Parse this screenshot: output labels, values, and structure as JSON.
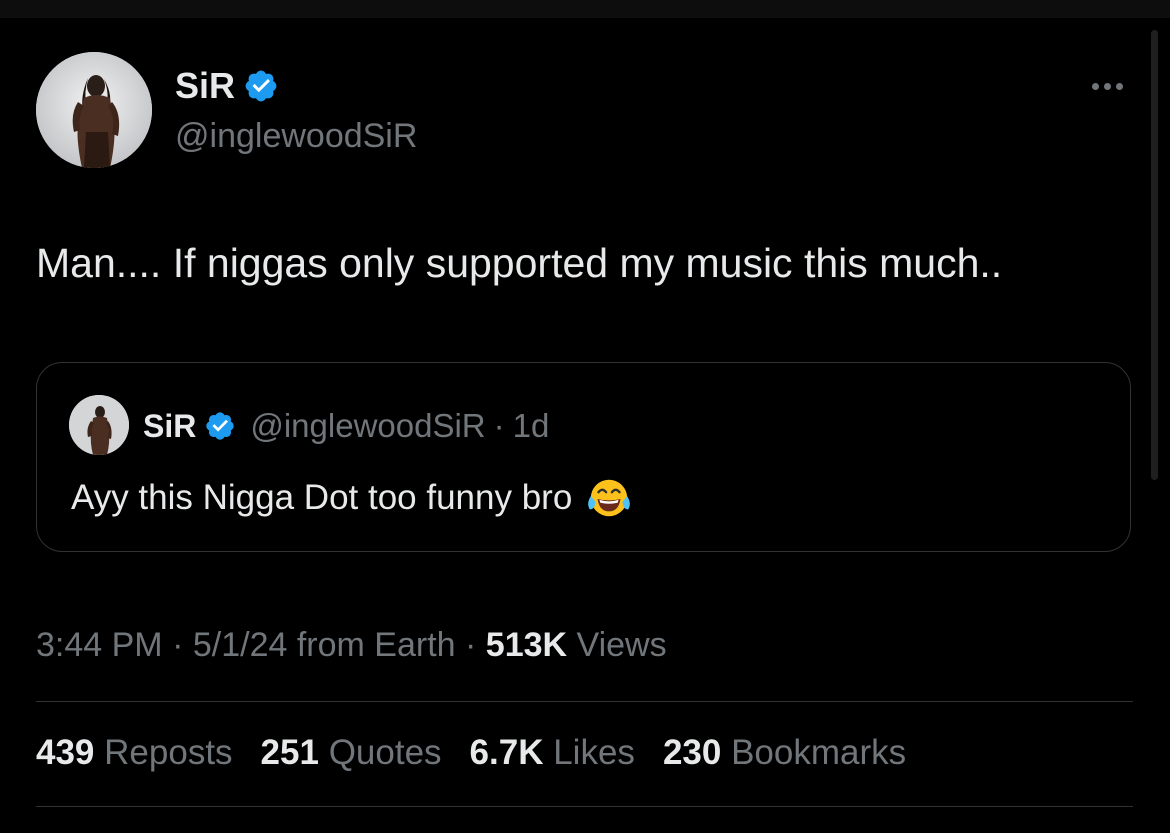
{
  "tweet": {
    "author": {
      "display_name": "SiR",
      "handle": "@inglewoodSiR",
      "verified": true
    },
    "text": "Man.... If niggas only supported my music this much..",
    "quoted_tweet": {
      "display_name": "SiR",
      "handle": "@inglewoodSiR",
      "separator": "·",
      "age": "1d",
      "text": "Ayy this Nigga Dot too funny bro",
      "emoji": "face-with-tears-of-joy"
    },
    "meta": {
      "time": "3:44 PM",
      "separator": "·",
      "date": "5/1/24",
      "source": "from Earth",
      "views_count": "513K",
      "views_label": "Views"
    },
    "stats": [
      {
        "count": "439",
        "label": "Reposts"
      },
      {
        "count": "251",
        "label": "Quotes"
      },
      {
        "count": "6.7K",
        "label": "Likes"
      },
      {
        "count": "230",
        "label": "Bookmarks"
      }
    ]
  },
  "colors": {
    "background": "#000000",
    "primary_text": "#e7e9ea",
    "secondary_text": "#71767b",
    "border": "#2f3336",
    "verified_blue": "#1d9bf0"
  }
}
